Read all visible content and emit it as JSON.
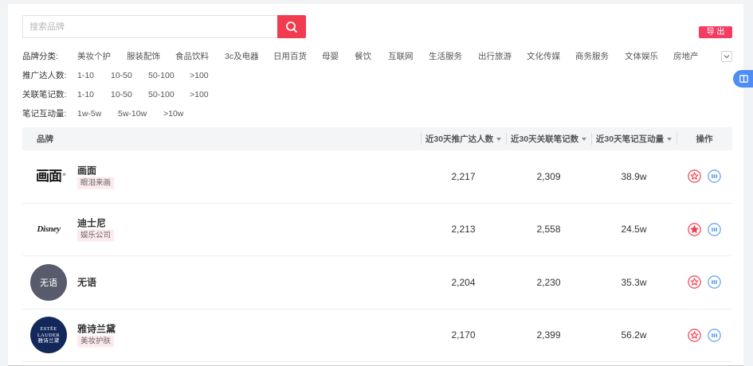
{
  "search": {
    "placeholder": "搜索品牌",
    "button_icon": "search-icon"
  },
  "toolbar": {
    "export_label": "导 出"
  },
  "filters": {
    "category": {
      "label": "品牌分类:",
      "options": [
        "美妆个护",
        "服装配饰",
        "食品饮料",
        "3c及电器",
        "日用百货",
        "母婴",
        "餐饮",
        "互联网",
        "生活服务",
        "出行旅游",
        "文化传媒",
        "商务服务",
        "文体娱乐",
        "房地产"
      ],
      "expand_icon": "chevron-down-icon"
    },
    "influencers": {
      "label": "推广达人数:",
      "options": [
        "1-10",
        "10-50",
        "50-100",
        ">100"
      ]
    },
    "notes": {
      "label": "关联笔记数:",
      "options": [
        "1-10",
        "10-50",
        "50-100",
        ">100"
      ]
    },
    "engagement": {
      "label": "笔记互动量:",
      "options": [
        "1w-5w",
        "5w-10w",
        ">10w"
      ]
    }
  },
  "table": {
    "columns": {
      "brand": "品牌",
      "influencers": "近30天推广达人数",
      "notes": "近30天关联笔记数",
      "engagement": "近30天笔记互动量",
      "actions": "操作"
    },
    "rows": [
      {
        "logo": {
          "text": "画面",
          "mark": "®"
        },
        "name": "画面",
        "tag": "眼泪来画",
        "influencers": "2,217",
        "notes": "2,309",
        "engagement": "38.9w",
        "favorited": false
      },
      {
        "logo": {
          "text": "Disney"
        },
        "name": "迪士尼",
        "tag": "娱乐公司",
        "influencers": "2,213",
        "notes": "2,558",
        "engagement": "24.5w",
        "favorited": true
      },
      {
        "logo": {
          "text": "无语"
        },
        "name": "无语",
        "influencers": "2,204",
        "notes": "2,230",
        "engagement": "35.3w",
        "favorited": false
      },
      {
        "logo": {
          "text": [
            "ESTĒE",
            "LAUDER",
            "雅诗兰黛"
          ]
        },
        "name": "雅诗兰黛",
        "tag": "美妆护肤",
        "influencers": "2,170",
        "notes": "2,399",
        "engagement": "56.2w",
        "favorited": false
      }
    ],
    "action_icons": [
      "favorite-star-icon",
      "analysis-icon"
    ]
  },
  "sidebar_toggle": {
    "icon": "sidebar-toggle-icon"
  },
  "colors": {
    "accent": "#f33b4f",
    "export": "#f53d63",
    "blue": "#5b9cf5",
    "tag_bg": "#fdeaee",
    "toggle": "#4d8df5"
  }
}
